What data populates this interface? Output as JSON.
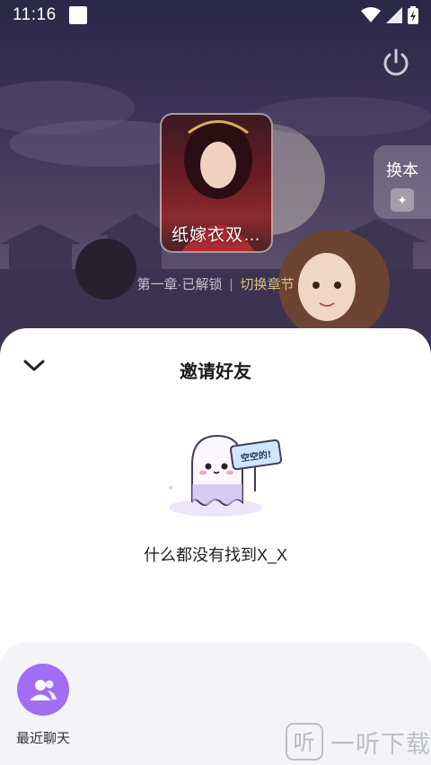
{
  "status_bar": {
    "time": "11:16"
  },
  "book": {
    "title": "纸嫁衣双…"
  },
  "chapter": {
    "label": "第一章·已解锁",
    "separator": "|",
    "switch_label": "切换章节"
  },
  "swap_tab": {
    "label": "换本"
  },
  "sheet": {
    "title": "邀请好友",
    "illustration_sign": "空空的!",
    "empty_message": "什么都没有找到X_X"
  },
  "recent_chat": {
    "label": "最近聊天"
  },
  "watermark": {
    "text": "一听下载"
  },
  "colors": {
    "accent_purple": "#a06ef5",
    "chapter_switch": "#d8c27a",
    "sheet_bg": "#ffffff",
    "panel_bg": "#f3f3f8"
  }
}
